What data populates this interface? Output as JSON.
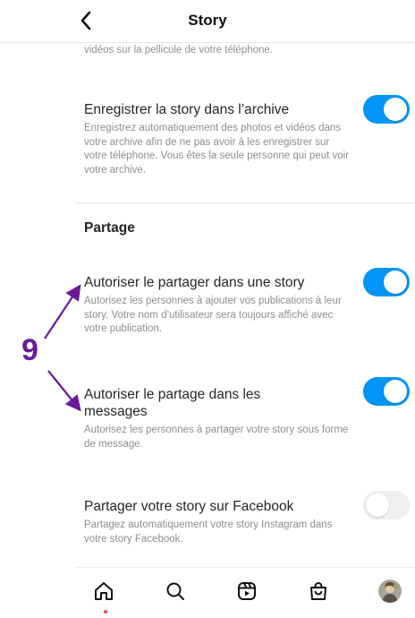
{
  "header": {
    "title": "Story"
  },
  "top_cut": {
    "description": "vidéos sur la pellicule de votre téléphone."
  },
  "settings": [
    {
      "title": "Enregistrer la story dans l’archive",
      "description": "Enregistrez automatiquement des photos et vidéos dans votre archive afin de ne pas avoir à les enregistrer sur votre téléphone. Vous êtes la seule personne qui peut voir votre archive.",
      "enabled": true
    },
    {
      "title": "Autoriser le partager dans une story",
      "description": "Autorisez les personnes à ajouter vos publications à leur story. Votre nom d’utilisateur sera toujours affiché avec votre publication.",
      "enabled": true
    },
    {
      "title": "Autoriser le partage dans les messages",
      "description": "Autorisez les personnes à partager votre story sous forme de message.",
      "enabled": true
    },
    {
      "title": "Partager votre story sur Facebook",
      "description": "Partagez automatiquement votre story Instagram dans votre story Facebook.",
      "enabled": false
    }
  ],
  "section": {
    "title": "Partage"
  },
  "annotation": {
    "number": "9",
    "color": "#6a1b9a"
  },
  "colors": {
    "toggle_on": "#0095f6",
    "toggle_off": "#efefef",
    "notification_dot": "#ed4956"
  },
  "tabbar": {
    "icons": [
      "home-icon",
      "search-icon",
      "reels-icon",
      "shop-icon",
      "profile-avatar"
    ]
  }
}
